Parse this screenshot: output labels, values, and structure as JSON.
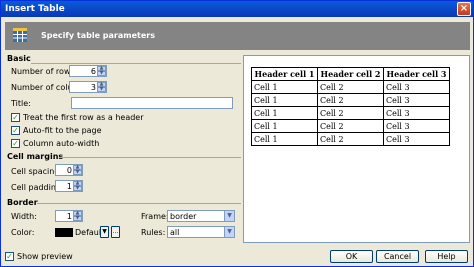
{
  "window": {
    "title": "Insert Table",
    "close_glyph": "×"
  },
  "banner": {
    "text": "Specify table parameters",
    "icon": "table-grid-icon"
  },
  "basic": {
    "heading": "Basic",
    "rows_label": "Number of rows:",
    "rows_value": "6",
    "columns_label": "Number of columns:",
    "columns_value": "3",
    "title_label": "Title:",
    "title_value": "",
    "treat_first_row": "Treat the first row as a header",
    "autofit": "Auto-fit to the page",
    "column_autowidth": "Column auto-width"
  },
  "cell_margins": {
    "heading": "Cell margins",
    "spacing_label": "Cell spacing:",
    "spacing_value": "0",
    "padding_label": "Cell padding:",
    "padding_value": "1"
  },
  "border": {
    "heading": "Border",
    "width_label": "Width:",
    "width_value": "1",
    "color_label": "Color:",
    "color_value": "Default",
    "color_swatch": "#000000",
    "frame_label": "Frame:",
    "frame_value": "border",
    "rules_label": "Rules:",
    "rules_value": "all"
  },
  "preview_table": {
    "headers": [
      "Header cell 1",
      "Header cell 2",
      "Header cell 3"
    ],
    "rows": [
      [
        "Cell 1",
        "Cell 2",
        "Cell 3"
      ],
      [
        "Cell 1",
        "Cell 2",
        "Cell 3"
      ],
      [
        "Cell 1",
        "Cell 2",
        "Cell 3"
      ],
      [
        "Cell 1",
        "Cell 2",
        "Cell 3"
      ],
      [
        "Cell 1",
        "Cell 2",
        "Cell 3"
      ]
    ]
  },
  "footer": {
    "show_preview": "Show preview",
    "ok": "OK",
    "cancel": "Cancel",
    "help": "Help"
  },
  "colors": {
    "title_bar": "#0a46c7",
    "banner": "#848484",
    "check": "#21a121"
  }
}
